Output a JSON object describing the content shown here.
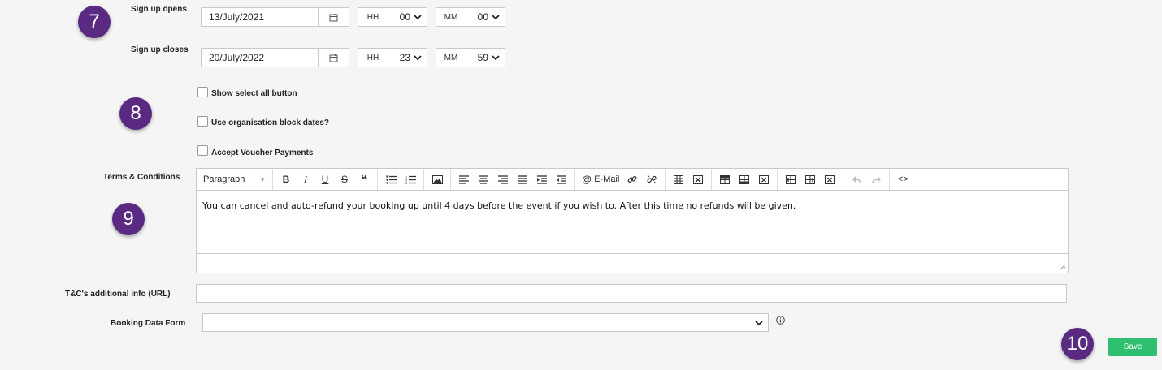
{
  "badges": {
    "b7": "7",
    "b8": "8",
    "b9": "9",
    "b10": "10"
  },
  "signup_opens": {
    "label": "Sign up opens",
    "date": "13/July/2021",
    "hh_label": "HH",
    "hh_value": "00",
    "mm_label": "MM",
    "mm_value": "00"
  },
  "signup_closes": {
    "label": "Sign up closes",
    "date": "20/July/2022",
    "hh_label": "HH",
    "hh_value": "23",
    "mm_label": "MM",
    "mm_value": "59"
  },
  "options": {
    "show_select_all": "Show select all button",
    "use_block_dates": "Use organisation block dates?",
    "accept_voucher": "Accept Voucher Payments"
  },
  "terms": {
    "label": "Terms & Conditions",
    "format": "Paragraph",
    "email_label": "E-Mail",
    "content": "You can cancel and auto-refund your booking up until 4 days before the event if you wish to.  After this time no refunds will be given."
  },
  "tc_url": {
    "label": "T&C's additional info (URL)",
    "value": ""
  },
  "booking_form": {
    "label": "Booking Data Form",
    "value": ""
  },
  "save_label": "Save",
  "colors": {
    "badge": "#5a2a82",
    "save": "#2fbf71"
  }
}
